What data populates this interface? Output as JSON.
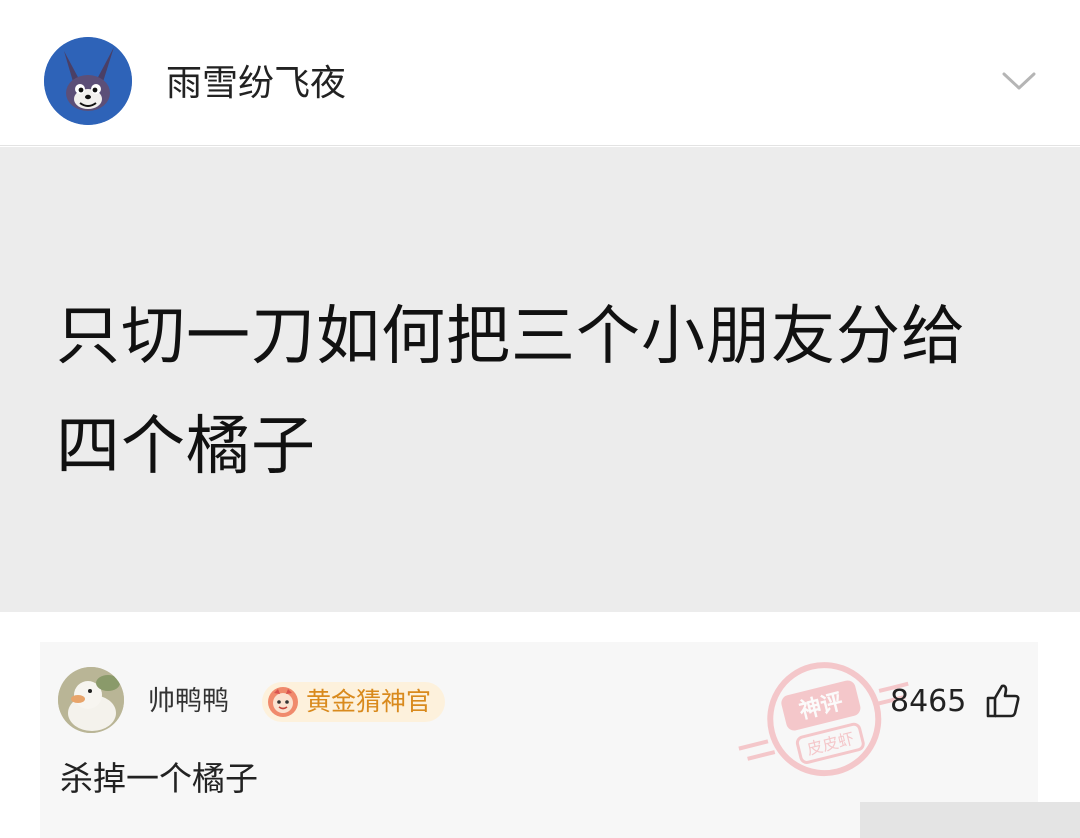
{
  "header": {
    "username": "雨雪纷飞夜",
    "avatar_icon": "rabbit-avatar-icon",
    "menu_icon": "chevron-down-icon"
  },
  "post": {
    "text": "只切一刀如何把三个小朋友分给四个橘子"
  },
  "comment": {
    "username": "帅鸭鸭",
    "avatar_icon": "duck-avatar-icon",
    "badge_icon": "gold-face-badge-icon",
    "badge_label": "黄金猜神官",
    "like_count": "8465",
    "like_icon": "thumbs-up-icon",
    "text": "杀掉一个橘子"
  },
  "watermark": {
    "icon": "shenping-pipixia-stamp"
  },
  "colors": {
    "post_background": "#ececec",
    "badge_text": "#d98a1d",
    "badge_background": "#fdf1dc",
    "avatar_blue": "#2e63b8"
  }
}
